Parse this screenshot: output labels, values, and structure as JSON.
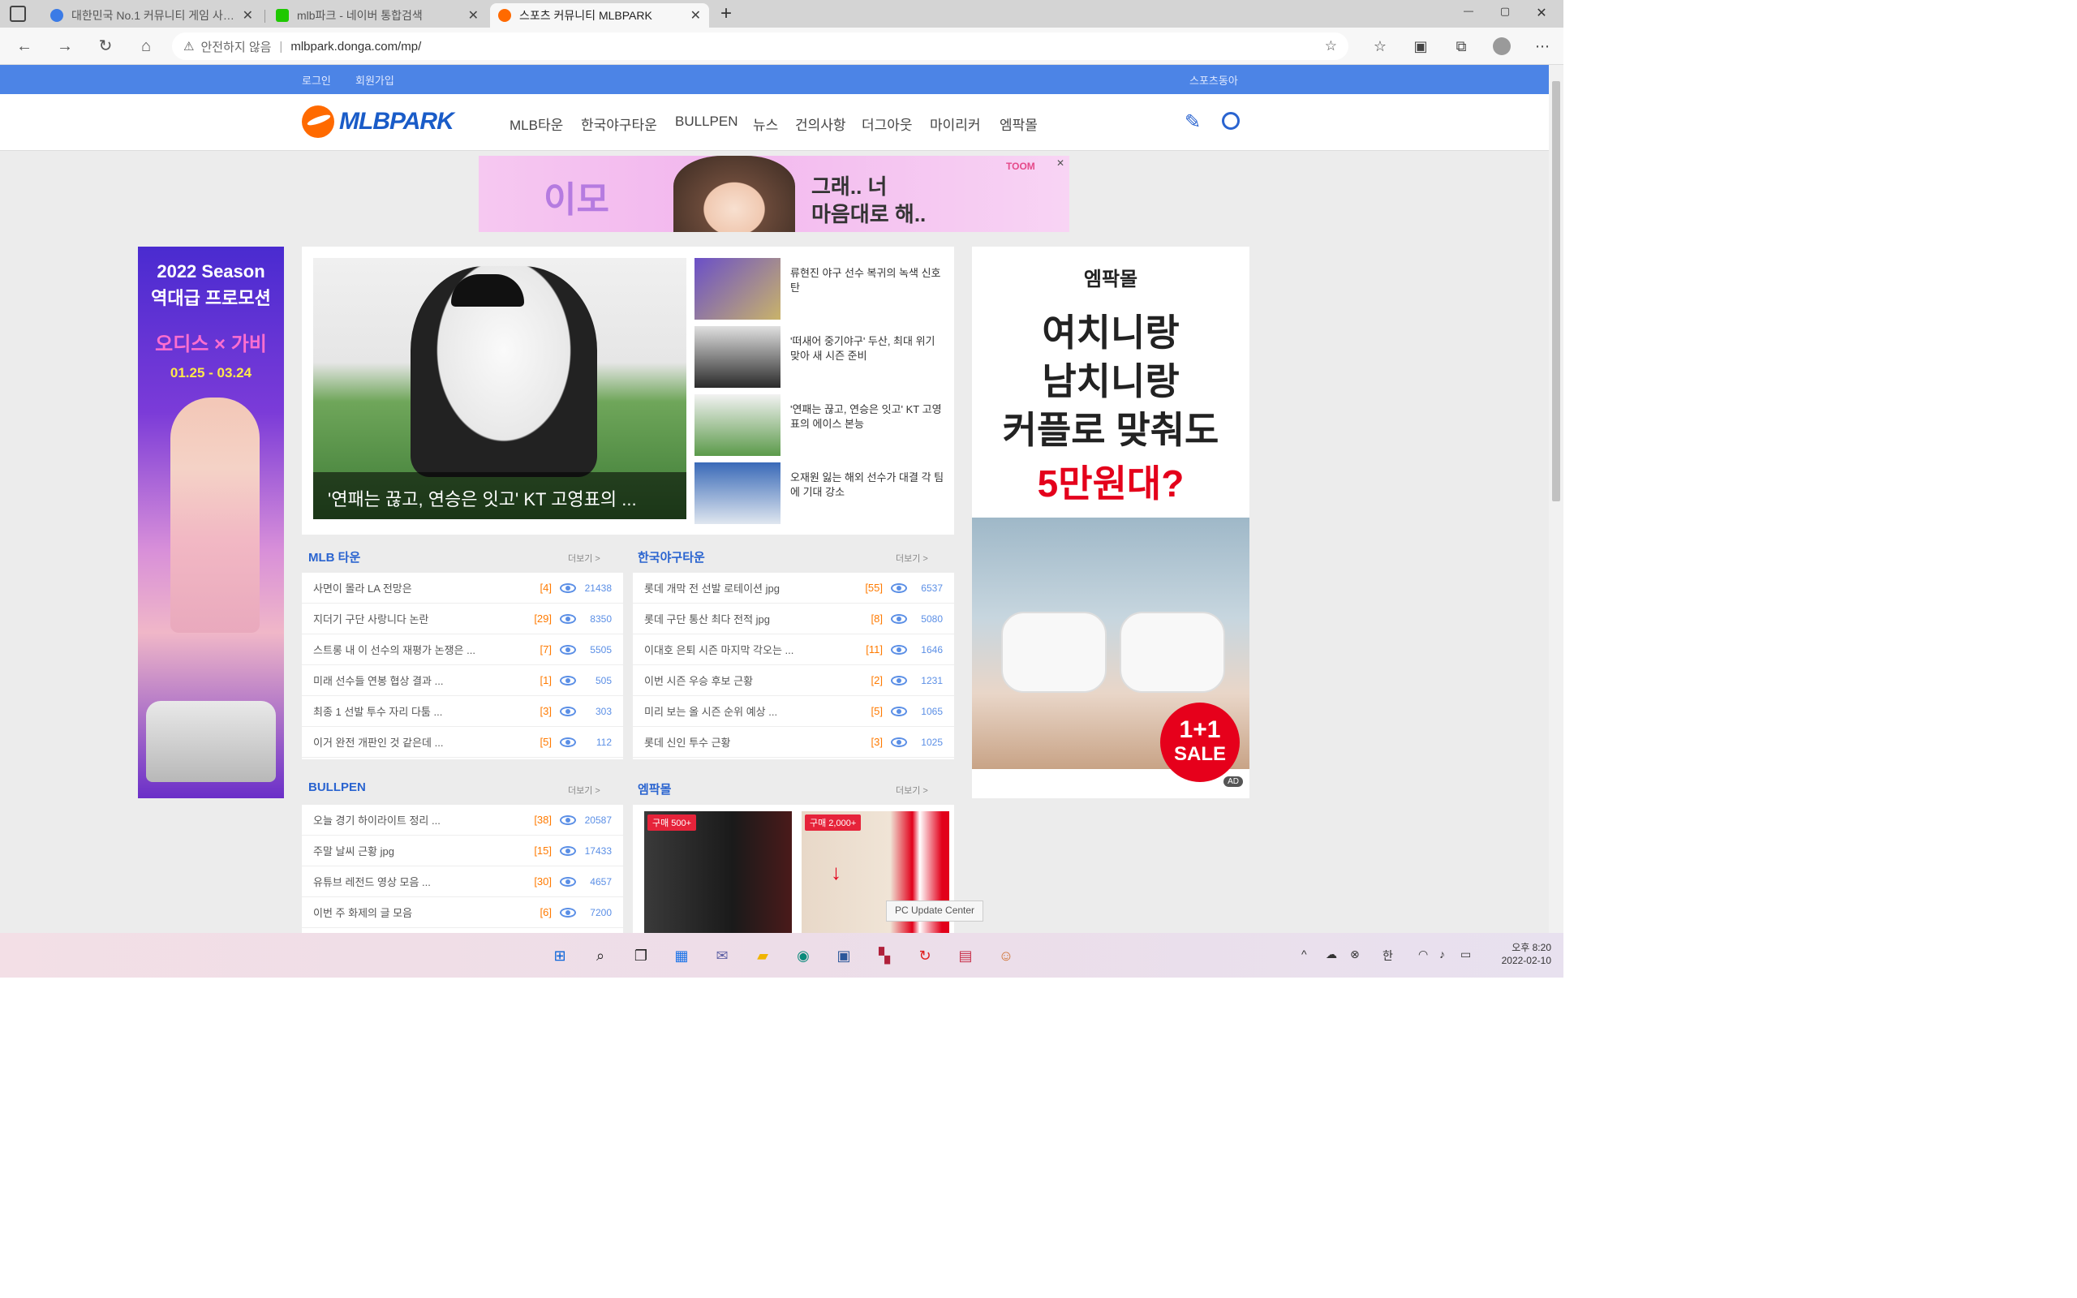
{
  "browser": {
    "tabs": [
      {
        "title": "대한민국 No.1 커뮤니티 게임 사이트",
        "active": false,
        "favicon_color": "#3b7be6"
      },
      {
        "title": "mlb파크 - 네이버 통합검색",
        "active": false,
        "favicon_color": "#1ec800"
      },
      {
        "title": "스포츠 커뮤니티 MLBPARK",
        "active": true,
        "favicon_color": "#ff6a00"
      }
    ],
    "new_tab_icon": "+",
    "window_controls": {
      "minimize": "—",
      "maximize": "▢",
      "close": "✕"
    },
    "address": {
      "security_icon": "⚠",
      "security_label": "안전하지 않음",
      "url": "mlbpark.donga.com/mp/"
    }
  },
  "site": {
    "topbar": {
      "login": "로그인",
      "join": "회원가입",
      "sports": "스포츠동아"
    },
    "logo": "MLBPARK",
    "menu": [
      "MLB타운",
      "한국야구타운",
      "BULLPEN",
      "뉴스",
      "건의사항",
      "더그아웃",
      "마이리커",
      "엠팍몰"
    ],
    "top_ad": {
      "logo_text": "이모",
      "line1": "그래.. 너",
      "line2": "마음대로 해..",
      "brand": "TOOM"
    },
    "left_ad": {
      "line1": "2022 Season",
      "line2": "역대급 프로모션",
      "collab": "오디스 × 가비",
      "dates": "01.25 - 03.24"
    },
    "headline": {
      "caption": "'연패는 끊고, 연승은 잇고' KT 고영표의 ..."
    },
    "side_news": [
      "류현진 야구 선수 복귀의 녹색 신호탄",
      "'떠새어 중기야구' 두산, 최대 위기 맞아 새 시즌 준비",
      "'연패는 끊고, 연승은 잇고' KT 고영표의 에이스 본능",
      "오재원 잃는 해외 선수가 대결 각 팀에 기대 강소"
    ],
    "mlb_town": {
      "title": "MLB 타운",
      "more": "더보기 >",
      "rows": [
        {
          "t": "사면이 몰라 LA 전망은",
          "c": "[4]",
          "v": "21438"
        },
        {
          "t": "지더기 구단 사랑니다 논란",
          "c": "[29]",
          "v": "8350"
        },
        {
          "t": "스트롱 내 이 선수의 재평가 논쟁은 ...",
          "c": "[7]",
          "v": "5505"
        },
        {
          "t": "미래 선수들 연봉 협상 결과 ...",
          "c": "[1]",
          "v": "505"
        },
        {
          "t": "최종 1 선발 투수 자리 다툼 ...",
          "c": "[3]",
          "v": "303"
        },
        {
          "t": "이거 완전 개판인 것 같은데 ...",
          "c": "[5]",
          "v": "112"
        }
      ]
    },
    "kbo_town": {
      "title": "한국야구타운",
      "more": "더보기 >",
      "rows": [
        {
          "t": "롯데 개막 전 선발 로테이션 jpg",
          "c": "[55]",
          "v": "6537"
        },
        {
          "t": "롯데 구단 통산 최다 전적 jpg",
          "c": "[8]",
          "v": "5080"
        },
        {
          "t": "이대호 은퇴 시즌 마지막 각오는 ...",
          "c": "[11]",
          "v": "1646"
        },
        {
          "t": "이번 시즌 우승 후보 근황",
          "c": "[2]",
          "v": "1231"
        },
        {
          "t": "미리 보는 올 시즌 순위 예상 ...",
          "c": "[5]",
          "v": "1065"
        },
        {
          "t": "롯데 신인 투수 근황",
          "c": "[3]",
          "v": "1025"
        }
      ]
    },
    "bullpen": {
      "title": "BULLPEN",
      "more": "더보기 >",
      "rows": [
        {
          "t": "오늘 경기 하이라이트 정리 ...",
          "c": "[38]",
          "v": "20587"
        },
        {
          "t": "주말 날씨 근황 jpg",
          "c": "[15]",
          "v": "17433"
        },
        {
          "t": "유튜브 레전드 영상 모음 ...",
          "c": "[30]",
          "v": "4657"
        },
        {
          "t": "이번 주 화제의 글 모음",
          "c": "[6]",
          "v": "7200"
        }
      ]
    },
    "mall": {
      "title": "엠팍몰",
      "more": "더보기 >",
      "items": [
        {
          "badge": "구매 500+"
        },
        {
          "badge": "구매 2,000+"
        }
      ]
    },
    "right_ad": {
      "brand": "엠팍몰",
      "copy1": "여치니랑",
      "copy2": "남치니랑",
      "copy3": "커플로 맞춰도",
      "copy4": "5만원대?",
      "sale1": "1+1",
      "sale2": "SALE",
      "ad_badge": "AD"
    },
    "tooltip": "PC Update Center"
  },
  "taskbar": {
    "ime": "한",
    "time": "오후 8:20",
    "date": "2022-02-10"
  }
}
